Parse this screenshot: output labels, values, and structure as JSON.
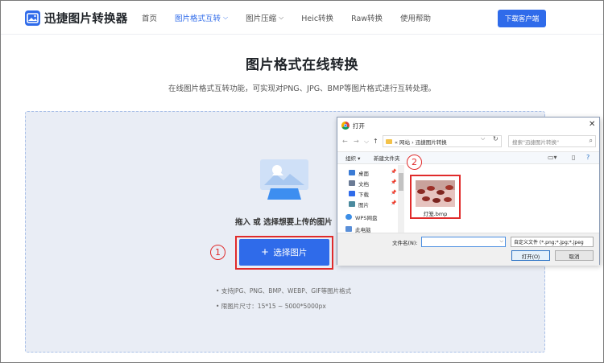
{
  "header": {
    "logo_text": "迅捷图片转换器",
    "nav": [
      {
        "label": "首页",
        "active": false
      },
      {
        "label": "图片格式互转",
        "active": true,
        "has_dropdown": true
      },
      {
        "label": "图片压缩",
        "active": false,
        "has_dropdown": true
      },
      {
        "label": "Heic转换",
        "active": false
      },
      {
        "label": "Raw转换",
        "active": false
      },
      {
        "label": "使用帮助",
        "active": false
      }
    ],
    "download_button": "下载客户端"
  },
  "main": {
    "title": "图片格式在线转换",
    "subtitle": "在线图片格式互转功能，可实现对PNG、JPG、BMP等图片格式进行互转处理。",
    "drop_hint": "拖入 或 选择想要上传的图片",
    "select_button": "选择图片",
    "requirements": [
      "• 支持JPG、PNG、BMP、WEBP、GIF等图片格式",
      "• 限图片尺寸：15*15 ~ 5000*5000px"
    ]
  },
  "markers": {
    "one": "1",
    "two": "2"
  },
  "dialog": {
    "title": "打开",
    "address": "« 网站 › 迅捷图片转换",
    "search_placeholder": "搜索\"迅捷图片转换\"",
    "toolbar": {
      "organize": "组织 ▾",
      "new_folder": "新建文件夹"
    },
    "sidebar": [
      {
        "label": "桌面",
        "icon": "desktop-icon",
        "color": "#3a7bd5",
        "pinned": true
      },
      {
        "label": "文档",
        "icon": "document-icon",
        "color": "#6b7b95",
        "pinned": true
      },
      {
        "label": "下载",
        "icon": "download-icon",
        "color": "#2f6bea",
        "pinned": true
      },
      {
        "label": "图片",
        "icon": "pictures-icon",
        "color": "#4a8a9e",
        "pinned": true
      },
      {
        "label": "WPS网盘",
        "icon": "cloud-icon",
        "color": "#3d8ee6",
        "pinned": false
      },
      {
        "label": "此电脑",
        "icon": "computer-icon",
        "color": "#5a8fd8",
        "pinned": false
      }
    ],
    "file": {
      "name": "灯笼.bmp"
    },
    "filename_label": "文件名(N):",
    "filename_value": "",
    "filter_value": "自定义文件 (*.png;*.jpg;*.jpeg",
    "open_button": "打开(O)",
    "cancel_button": "取消"
  },
  "colors": {
    "accent": "#2f6bea",
    "highlight": "#e02b2b",
    "dropzone": "#e9edf5"
  }
}
